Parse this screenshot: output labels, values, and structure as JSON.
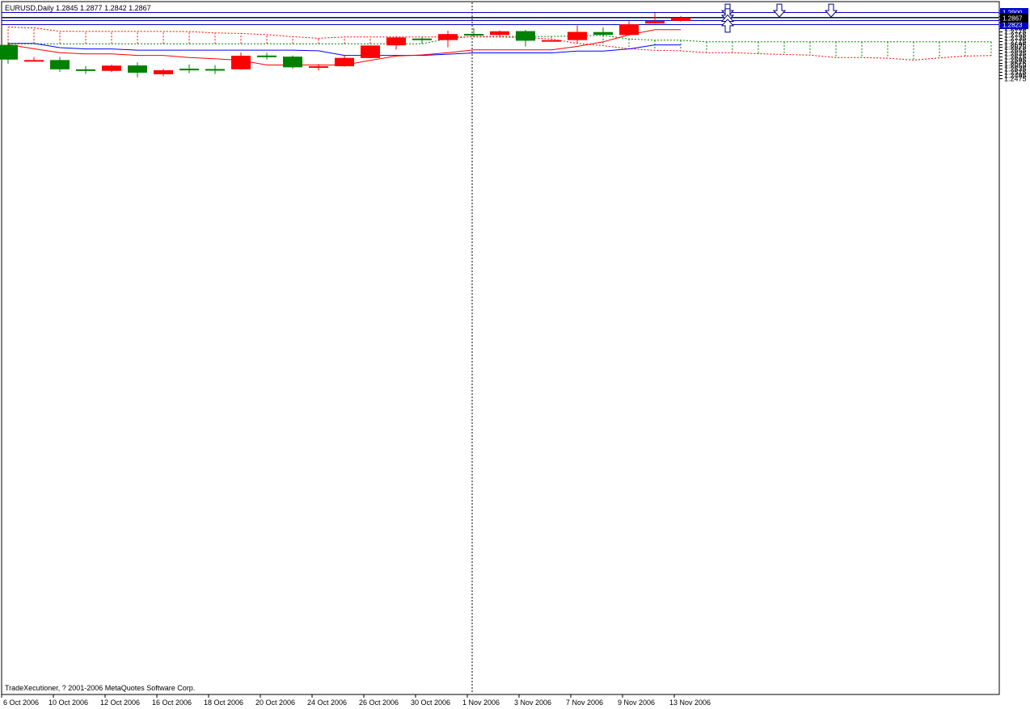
{
  "header": {
    "title": "EURUSD,Daily  1.2845 1.2877 1.2842 1.2867"
  },
  "footer": {
    "copyright": "TradeXecutioner, ? 2001-2006 MetaQuotes Software Corp."
  },
  "colors": {
    "bull": "#008000",
    "bear": "#ff0000",
    "tenkan": "#ff0000",
    "kijun": "#0000ff",
    "level_line": "#0000cc",
    "current_price_line": "#708090",
    "cloud_red": "#ff0000",
    "cloud_green": "#008000",
    "arrow": "#000080"
  },
  "chart_data": {
    "type": "candlestick",
    "symbol": "EURUSD",
    "timeframe": "Daily",
    "ylim": [
      1.2465,
      1.2925
    ],
    "yticks": [
      "1.2915",
      "1.2895",
      "1.2875",
      "1.2855",
      "1.2835",
      "1.2815",
      "1.2795",
      "1.2775",
      "1.2755",
      "1.2735",
      "1.2715",
      "1.2695",
      "1.2675",
      "1.2655",
      "1.2635",
      "1.2615",
      "1.2595",
      "1.2575",
      "1.2555",
      "1.2535",
      "1.2515",
      "1.2495",
      "1.2475"
    ],
    "x_labels": [
      "6 Oct 2006",
      "10 Oct 2006",
      "12 Oct 2006",
      "16 Oct 2006",
      "18 Oct 2006",
      "20 Oct 2006",
      "24 Oct 2006",
      "26 Oct 2006",
      "30 Oct 2006",
      "1 Nov 2006",
      "3 Nov 2006",
      "7 Nov 2006",
      "9 Nov 2006",
      "13 Nov 2006"
    ],
    "vline_index": 18,
    "candles": [
      {
        "o": 1.2595,
        "h": 1.271,
        "l": 1.2568,
        "c": 1.269
      },
      {
        "o": 1.2592,
        "h": 1.2612,
        "l": 1.2585,
        "c": 1.2589
      },
      {
        "o": 1.2532,
        "h": 1.2612,
        "l": 1.2515,
        "c": 1.2592
      },
      {
        "o": 1.2522,
        "h": 1.2553,
        "l": 1.2502,
        "c": 1.2532
      },
      {
        "o": 1.2556,
        "h": 1.2562,
        "l": 1.2515,
        "c": 1.2522
      },
      {
        "o": 1.251,
        "h": 1.2577,
        "l": 1.248,
        "c": 1.2557
      },
      {
        "o": 1.2526,
        "h": 1.2536,
        "l": 1.2487,
        "c": 1.25
      },
      {
        "o": 1.2526,
        "h": 1.2564,
        "l": 1.2507,
        "c": 1.2536
      },
      {
        "o": 1.2531,
        "h": 1.2559,
        "l": 1.2502,
        "c": 1.2534
      },
      {
        "o": 1.262,
        "h": 1.2641,
        "l": 1.253,
        "c": 1.2532
      },
      {
        "o": 1.2611,
        "h": 1.2639,
        "l": 1.2596,
        "c": 1.2621
      },
      {
        "o": 1.2545,
        "h": 1.2621,
        "l": 1.2535,
        "c": 1.2614
      },
      {
        "o": 1.2552,
        "h": 1.2565,
        "l": 1.2524,
        "c": 1.2545
      },
      {
        "o": 1.2606,
        "h": 1.262,
        "l": 1.2549,
        "c": 1.2552
      },
      {
        "o": 1.2686,
        "h": 1.2686,
        "l": 1.2604,
        "c": 1.2605
      },
      {
        "o": 1.2738,
        "h": 1.2746,
        "l": 1.266,
        "c": 1.2687
      },
      {
        "o": 1.2722,
        "h": 1.2738,
        "l": 1.2698,
        "c": 1.2731
      },
      {
        "o": 1.276,
        "h": 1.2782,
        "l": 1.2675,
        "c": 1.2721
      },
      {
        "o": 1.2755,
        "h": 1.2799,
        "l": 1.2741,
        "c": 1.2761
      },
      {
        "o": 1.2778,
        "h": 1.2784,
        "l": 1.2738,
        "c": 1.2754
      },
      {
        "o": 1.2717,
        "h": 1.2787,
        "l": 1.268,
        "c": 1.2779
      },
      {
        "o": 1.2721,
        "h": 1.2724,
        "l": 1.2714,
        "c": 1.2716
      },
      {
        "o": 1.2774,
        "h": 1.2816,
        "l": 1.2705,
        "c": 1.2721
      },
      {
        "o": 1.2755,
        "h": 1.2803,
        "l": 1.274,
        "c": 1.2773
      },
      {
        "o": 1.2823,
        "h": 1.2843,
        "l": 1.275,
        "c": 1.2754
      },
      {
        "o": 1.2844,
        "h": 1.2897,
        "l": 1.2826,
        "c": 1.2828
      },
      {
        "o": 1.2867,
        "h": 1.2877,
        "l": 1.2842,
        "c": 1.2845
      }
    ],
    "tenkan": [
      1.2692,
      1.2665,
      1.264,
      1.2632,
      1.2632,
      1.2622,
      1.2622,
      1.2608,
      1.26,
      1.259,
      1.256,
      1.256,
      1.256,
      1.256,
      1.259,
      1.2618,
      1.2625,
      1.264,
      1.2658,
      1.2658,
      1.2658,
      1.2658,
      1.268,
      1.271,
      1.2755,
      1.2788,
      1.2788
    ],
    "kijun": [
      1.27,
      1.27,
      1.2672,
      1.2664,
      1.2664,
      1.2656,
      1.2656,
      1.2656,
      1.2656,
      1.2656,
      1.2656,
      1.2656,
      1.2652,
      1.2622,
      1.2622,
      1.2622,
      1.2622,
      1.263,
      1.2638,
      1.2638,
      1.2638,
      1.2638,
      1.265,
      1.265,
      1.2664,
      1.269,
      1.269
    ],
    "senkou_a": [
      1.2697,
      1.2697,
      1.2697,
      1.2697,
      1.2697,
      1.2697,
      1.2697,
      1.2697,
      1.2697,
      1.2697,
      1.2697,
      1.2697,
      1.2697,
      1.2697,
      1.2697,
      1.2697,
      1.2697,
      1.273,
      1.2745,
      1.2745,
      1.2745,
      1.2745,
      1.2748,
      1.2752,
      1.2728,
      1.272,
      1.272,
      1.271,
      1.271,
      1.271,
      1.271,
      1.271,
      1.271,
      1.271,
      1.271,
      1.271,
      1.271,
      1.271,
      1.271
    ],
    "senkou_b": [
      1.2805,
      1.28,
      1.2778,
      1.2777,
      1.2777,
      1.2777,
      1.2777,
      1.2776,
      1.2767,
      1.2764,
      1.2756,
      1.2743,
      1.2733,
      1.2741,
      1.2741,
      1.2741,
      1.2741,
      1.2741,
      1.2741,
      1.2741,
      1.2737,
      1.2728,
      1.27,
      1.2685,
      1.2665,
      1.2655,
      1.2652,
      1.264,
      1.264,
      1.2633,
      1.2628,
      1.2624,
      1.2608,
      1.2608,
      1.2604,
      1.2592,
      1.2606,
      1.2618,
      1.2621
    ],
    "levels": [
      {
        "price": 1.29,
        "label": "1.2900",
        "badge": "#0000cc",
        "text": "#ffffff"
      },
      {
        "price": 1.2873,
        "label": "1.2873",
        "badge": "#0000cc",
        "text": "#ffffff"
      },
      {
        "price": 1.285,
        "label": "1.2850",
        "badge": "#0000cc",
        "text": "#ffffff"
      },
      {
        "price": 1.2823,
        "label": "1.2823",
        "badge": "#0000cc",
        "text": "#ffffff"
      }
    ],
    "current": {
      "price": 1.2867,
      "label": "1.2867",
      "badge": "#000000",
      "text": "#ffffff"
    },
    "arrows": [
      {
        "index": 28,
        "price": 1.2912,
        "dir": "down"
      },
      {
        "index": 30,
        "price": 1.2912,
        "dir": "down"
      },
      {
        "index": 32,
        "price": 1.2912,
        "dir": "down"
      },
      {
        "index": 28,
        "price": 1.2882,
        "dir": "down"
      },
      {
        "index": 28,
        "price": 1.2842,
        "dir": "up"
      },
      {
        "index": 28,
        "price": 1.2814,
        "dir": "up"
      }
    ]
  }
}
